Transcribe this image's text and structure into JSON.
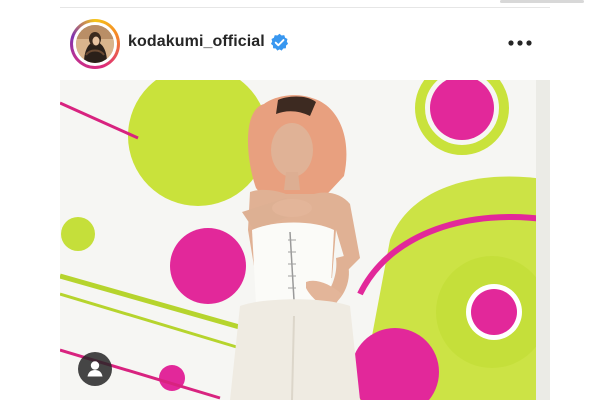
{
  "post": {
    "username": "kodakumi_official"
  },
  "icons": {
    "verified": "verified-badge-icon",
    "more": "more-options-icon",
    "user_tag": "user-tag-icon"
  },
  "colors": {
    "verified_blue": "#3897f0",
    "lime": "#c6e23a",
    "magenta": "#e0238a",
    "text": "#262626"
  }
}
